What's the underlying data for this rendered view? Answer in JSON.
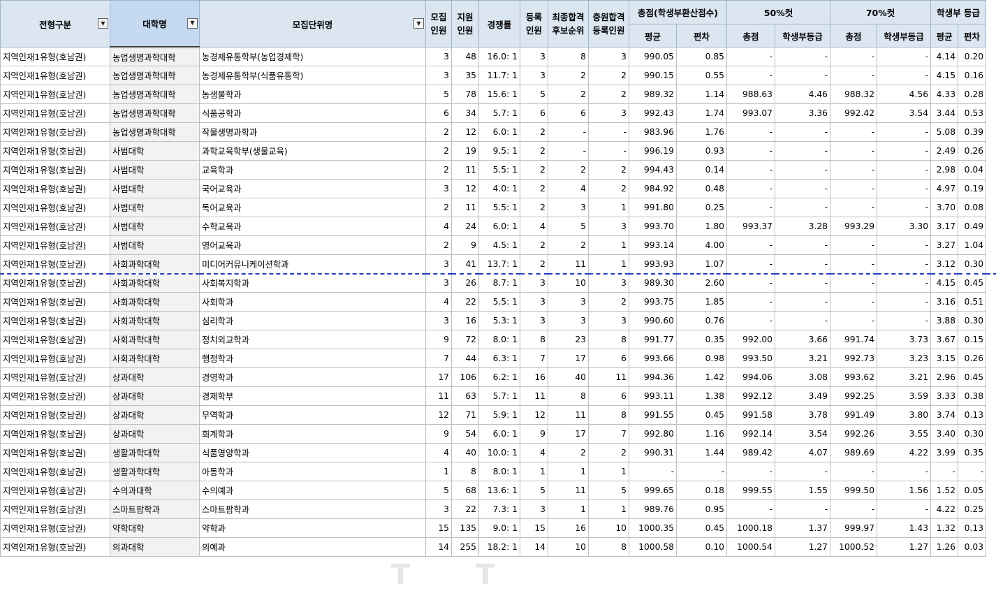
{
  "header": {
    "jeonhyeong": "전형구분",
    "daehak": "대학명",
    "mojip_danwi": "모집단위명",
    "mojip_inwon": [
      "모집",
      "인원"
    ],
    "jiwon_inwon": [
      "지원",
      "인원"
    ],
    "gyeongjaeng": "경쟁률",
    "deungrok_inwon": [
      "등록",
      "인원"
    ],
    "choejong": [
      "최종합격",
      "후보순위"
    ],
    "chungwon": [
      "충원합격",
      "등록인원"
    ],
    "total_group": "총점(학생부환산점수)",
    "cut50_group": "50%컷",
    "cut70_group": "70%컷",
    "grade_group": "학생부 등급",
    "avg": "평균",
    "dev": "편차",
    "cut_total": "총점",
    "cut_grade": "학생부등급",
    "filter_icon": "▼"
  },
  "rows": [
    [
      "지역인재1유형(호남권)",
      "농업생명과학대학",
      "농경제유통학부(농업경제학)",
      "3",
      "48",
      "16.0: 1",
      "3",
      "8",
      "3",
      "990.05",
      "0.85",
      "-",
      "-",
      "-",
      "-",
      "4.14",
      "0.20"
    ],
    [
      "지역인재1유형(호남권)",
      "농업생명과학대학",
      "농경제유통학부(식품유통학)",
      "3",
      "35",
      "11.7: 1",
      "3",
      "2",
      "2",
      "990.15",
      "0.55",
      "-",
      "-",
      "-",
      "-",
      "4.15",
      "0.16"
    ],
    [
      "지역인재1유형(호남권)",
      "농업생명과학대학",
      "농생물학과",
      "5",
      "78",
      "15.6: 1",
      "5",
      "2",
      "2",
      "989.32",
      "1.14",
      "988.63",
      "4.46",
      "988.32",
      "4.56",
      "4.33",
      "0.28"
    ],
    [
      "지역인재1유형(호남권)",
      "농업생명과학대학",
      "식품공학과",
      "6",
      "34",
      "5.7: 1",
      "6",
      "6",
      "3",
      "992.43",
      "1.74",
      "993.07",
      "3.36",
      "992.42",
      "3.54",
      "3.44",
      "0.53"
    ],
    [
      "지역인재1유형(호남권)",
      "농업생명과학대학",
      "작물생명과학과",
      "2",
      "12",
      "6.0: 1",
      "2",
      "-",
      "-",
      "983.96",
      "1.76",
      "-",
      "-",
      "-",
      "-",
      "5.08",
      "0.39"
    ],
    [
      "지역인재1유형(호남권)",
      "사범대학",
      "과학교육학부(생물교육)",
      "2",
      "19",
      "9.5: 1",
      "2",
      "-",
      "-",
      "996.19",
      "0.93",
      "-",
      "-",
      "-",
      "-",
      "2.49",
      "0.26"
    ],
    [
      "지역인재1유형(호남권)",
      "사범대학",
      "교육학과",
      "2",
      "11",
      "5.5: 1",
      "2",
      "2",
      "2",
      "994.43",
      "0.14",
      "-",
      "-",
      "-",
      "-",
      "2.98",
      "0.04"
    ],
    [
      "지역인재1유형(호남권)",
      "사범대학",
      "국어교육과",
      "3",
      "12",
      "4.0: 1",
      "2",
      "4",
      "2",
      "984.92",
      "0.48",
      "-",
      "-",
      "-",
      "-",
      "4.97",
      "0.19"
    ],
    [
      "지역인재1유형(호남권)",
      "사범대학",
      "독어교육과",
      "2",
      "11",
      "5.5: 1",
      "2",
      "3",
      "1",
      "991.80",
      "0.25",
      "-",
      "-",
      "-",
      "-",
      "3.70",
      "0.08"
    ],
    [
      "지역인재1유형(호남권)",
      "사범대학",
      "수학교육과",
      "4",
      "24",
      "6.0: 1",
      "4",
      "5",
      "3",
      "993.70",
      "1.80",
      "993.37",
      "3.28",
      "993.29",
      "3.30",
      "3.17",
      "0.49"
    ],
    [
      "지역인재1유형(호남권)",
      "사범대학",
      "영어교육과",
      "2",
      "9",
      "4.5: 1",
      "2",
      "2",
      "1",
      "993.14",
      "4.00",
      "-",
      "-",
      "-",
      "-",
      "3.27",
      "1.04"
    ],
    [
      "지역인재1유형(호남권)",
      "사회과학대학",
      "미디어커뮤니케이션학과",
      "3",
      "41",
      "13.7: 1",
      "2",
      "11",
      "1",
      "993.93",
      "1.07",
      "-",
      "-",
      "-",
      "-",
      "3.12",
      "0.30"
    ],
    [
      "지역인재1유형(호남권)",
      "사회과학대학",
      "사회복지학과",
      "3",
      "26",
      "8.7: 1",
      "3",
      "10",
      "3",
      "989.30",
      "2.60",
      "-",
      "-",
      "-",
      "-",
      "4.15",
      "0.45"
    ],
    [
      "지역인재1유형(호남권)",
      "사회과학대학",
      "사회학과",
      "4",
      "22",
      "5.5: 1",
      "3",
      "3",
      "2",
      "993.75",
      "1.85",
      "-",
      "-",
      "-",
      "-",
      "3.16",
      "0.51"
    ],
    [
      "지역인재1유형(호남권)",
      "사회과학대학",
      "심리학과",
      "3",
      "16",
      "5.3: 1",
      "3",
      "3",
      "3",
      "990.60",
      "0.76",
      "-",
      "-",
      "-",
      "-",
      "3.88",
      "0.30"
    ],
    [
      "지역인재1유형(호남권)",
      "사회과학대학",
      "정치외교학과",
      "9",
      "72",
      "8.0: 1",
      "8",
      "23",
      "8",
      "991.77",
      "0.35",
      "992.00",
      "3.66",
      "991.74",
      "3.73",
      "3.67",
      "0.15"
    ],
    [
      "지역인재1유형(호남권)",
      "사회과학대학",
      "행정학과",
      "7",
      "44",
      "6.3: 1",
      "7",
      "17",
      "6",
      "993.66",
      "0.98",
      "993.50",
      "3.21",
      "992.73",
      "3.23",
      "3.15",
      "0.26"
    ],
    [
      "지역인재1유형(호남권)",
      "상과대학",
      "경영학과",
      "17",
      "106",
      "6.2: 1",
      "16",
      "40",
      "11",
      "994.36",
      "1.42",
      "994.06",
      "3.08",
      "993.62",
      "3.21",
      "2.96",
      "0.45"
    ],
    [
      "지역인재1유형(호남권)",
      "상과대학",
      "경제학부",
      "11",
      "63",
      "5.7: 1",
      "11",
      "8",
      "6",
      "993.11",
      "1.38",
      "992.12",
      "3.49",
      "992.25",
      "3.59",
      "3.33",
      "0.38"
    ],
    [
      "지역인재1유형(호남권)",
      "상과대학",
      "무역학과",
      "12",
      "71",
      "5.9: 1",
      "12",
      "11",
      "8",
      "991.55",
      "0.45",
      "991.58",
      "3.78",
      "991.49",
      "3.80",
      "3.74",
      "0.13"
    ],
    [
      "지역인재1유형(호남권)",
      "상과대학",
      "회계학과",
      "9",
      "54",
      "6.0: 1",
      "9",
      "17",
      "7",
      "992.80",
      "1.16",
      "992.14",
      "3.54",
      "992.26",
      "3.55",
      "3.40",
      "0.30"
    ],
    [
      "지역인재1유형(호남권)",
      "생활과학대학",
      "식품영양학과",
      "4",
      "40",
      "10.0: 1",
      "4",
      "2",
      "2",
      "990.31",
      "1.44",
      "989.42",
      "4.07",
      "989.69",
      "4.22",
      "3.99",
      "0.35"
    ],
    [
      "지역인재1유형(호남권)",
      "생활과학대학",
      "아동학과",
      "1",
      "8",
      "8.0: 1",
      "1",
      "1",
      "1",
      "-",
      "-",
      "-",
      "-",
      "-",
      "-",
      "-",
      "-"
    ],
    [
      "지역인재1유형(호남권)",
      "수의과대학",
      "수의예과",
      "5",
      "68",
      "13.6: 1",
      "5",
      "11",
      "5",
      "999.65",
      "0.18",
      "999.55",
      "1.55",
      "999.50",
      "1.56",
      "1.52",
      "0.05"
    ],
    [
      "지역인재1유형(호남권)",
      "스마트팜학과",
      "스마트팜학과",
      "3",
      "22",
      "7.3: 1",
      "3",
      "1",
      "1",
      "989.76",
      "0.95",
      "-",
      "-",
      "-",
      "-",
      "4.22",
      "0.25"
    ],
    [
      "지역인재1유형(호남권)",
      "약학대학",
      "약학과",
      "15",
      "135",
      "9.0: 1",
      "15",
      "16",
      "10",
      "1000.35",
      "0.45",
      "1000.18",
      "1.37",
      "999.97",
      "1.43",
      "1.32",
      "0.13"
    ],
    [
      "지역인재1유형(호남권)",
      "의과대학",
      "의예과",
      "14",
      "255",
      "18.2: 1",
      "14",
      "10",
      "8",
      "1000.58",
      "0.10",
      "1000.54",
      "1.27",
      "1000.52",
      "1.27",
      "1.26",
      "0.03"
    ]
  ],
  "watermark": "T     T"
}
